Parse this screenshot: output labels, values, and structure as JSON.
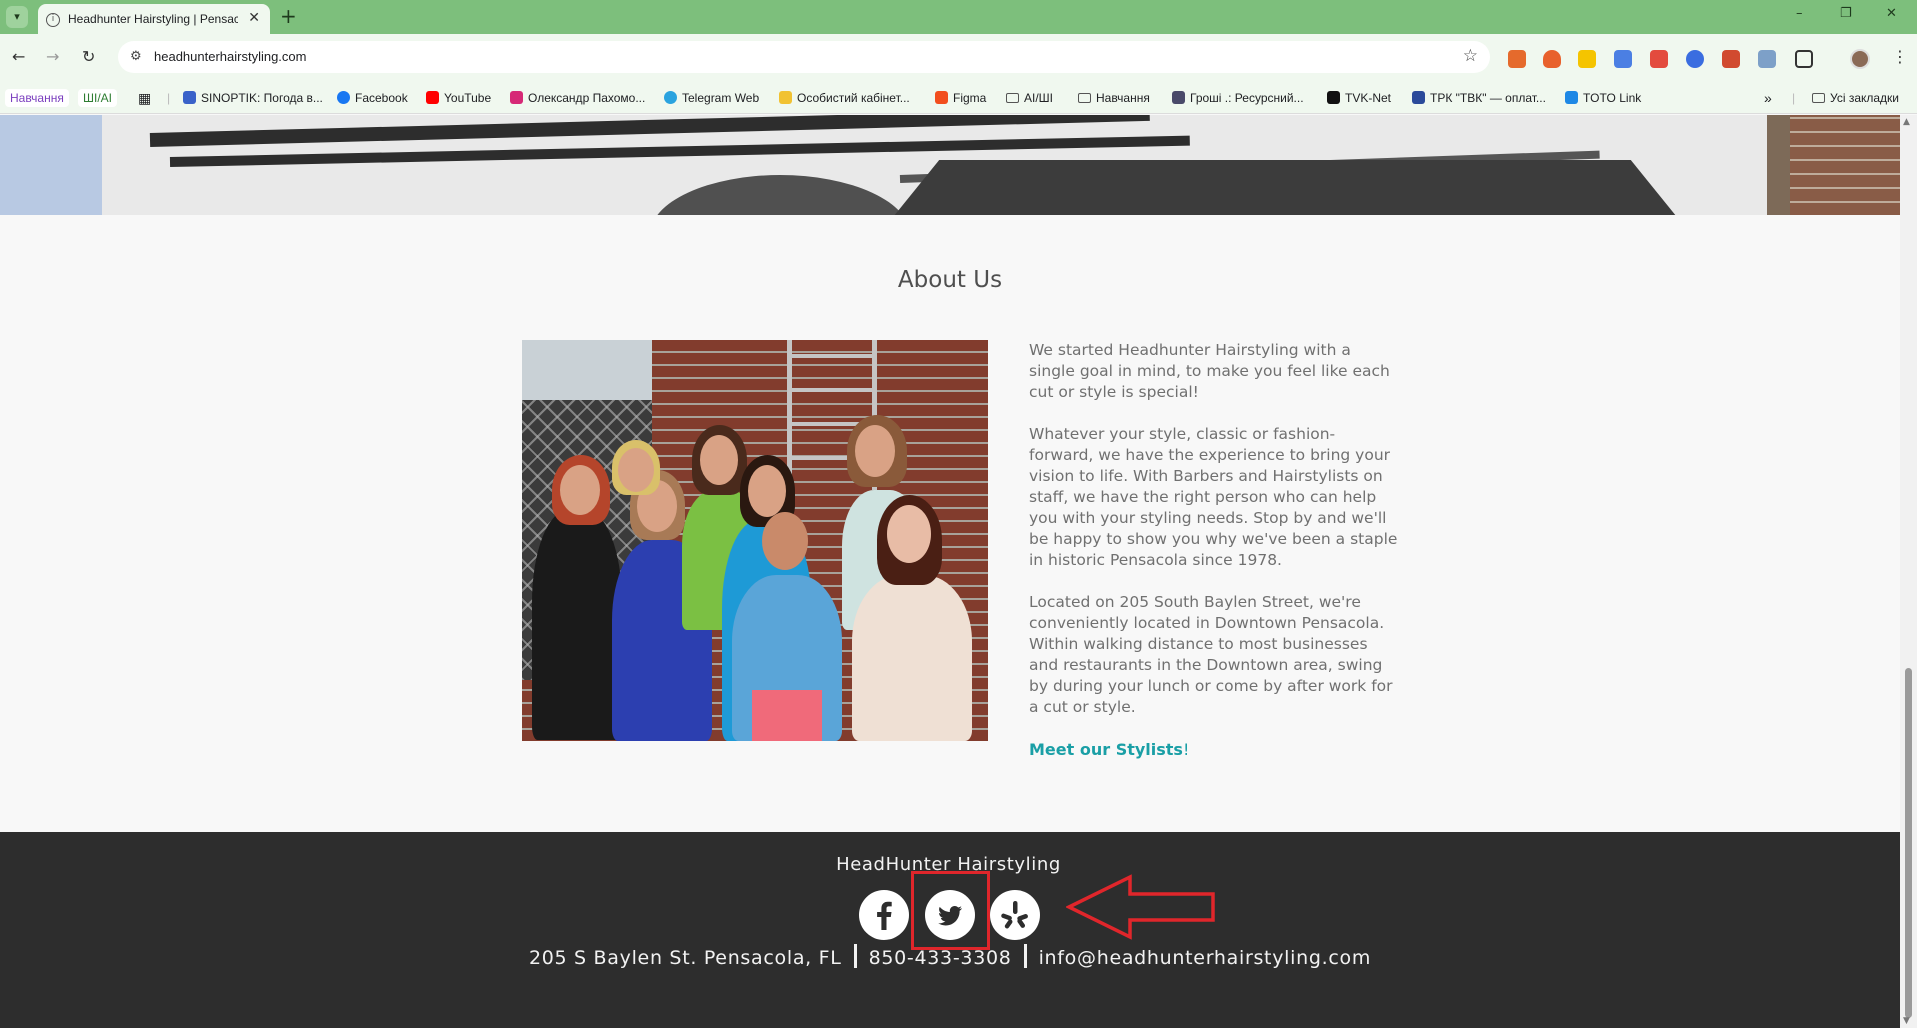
{
  "browser": {
    "tab_title": "Headhunter Hairstyling | Pensacola",
    "url": "headhunterhairstyling.com",
    "win_min": "–",
    "win_max": "❐",
    "win_close": "✕",
    "new_tab": "+",
    "tab_close": "✕"
  },
  "bookmarks": [
    {
      "label": "Навчання",
      "icon": "pill"
    },
    {
      "label": "ШІ/AI",
      "icon": "pill"
    },
    {
      "label": "",
      "icon": "grid-icon"
    },
    {
      "label": "SINOPTIK: Погода в...",
      "icon": "thermometer-icon"
    },
    {
      "label": "Facebook",
      "icon": "facebook-icon"
    },
    {
      "label": "YouTube",
      "icon": "youtube-icon"
    },
    {
      "label": "Олександр Пахомо...",
      "icon": "instagram-icon"
    },
    {
      "label": "Telegram Web",
      "icon": "telegram-icon"
    },
    {
      "label": "Особистий кабінет...",
      "icon": "cabinet-icon"
    },
    {
      "label": "Figma",
      "icon": "figma-icon"
    },
    {
      "label": "AI/ШІ",
      "icon": "folder-icon"
    },
    {
      "label": "Навчання",
      "icon": "folder-icon"
    },
    {
      "label": "Гроші .: Ресурсний...",
      "icon": "money-icon"
    },
    {
      "label": "TVK-Net",
      "icon": "tvk-icon"
    },
    {
      "label": "ТРК \"ТВК\" — оплат...",
      "icon": "trk-icon"
    },
    {
      "label": "TOTO Link",
      "icon": "toto-icon"
    },
    {
      "label": "»",
      "icon": "more-icon"
    },
    {
      "label": "Усі закладки",
      "icon": "folder-icon"
    }
  ],
  "page": {
    "section_title": "About Us",
    "paragraph1": "We started Headhunter Hairstyling with a single goal in mind, to make you feel like each cut or style is special!",
    "paragraph2": "Whatever your style, classic or fashion-forward, we have the experience to bring your vision to life. With Barbers and Hairstylists on staff, we have the right person who can help you with your styling needs. Stop by and we'll be happy to show you why we've been a staple in historic Pensacola since 1978.",
    "paragraph3": "Located on 205 South Baylen Street, we're conveniently located in Downtown Pensacola. Within walking distance to most businesses and restaurants in the Downtown area, swing by during your lunch or come by after work for a cut or style.",
    "stylists_link": "Meet our Stylists",
    "stylists_suffix": "!"
  },
  "footer": {
    "name": "HeadHunter Hairstyling",
    "address": "205 S Baylen St. Pensacola, FL",
    "phone": "850-433-3308",
    "email": "info@headhunterhairstyling.com",
    "social": [
      "facebook-icon",
      "twitter-icon",
      "yelp-icon"
    ]
  },
  "colors": {
    "accent": "#1a9fa6",
    "footer_bg": "#2d2d2d",
    "highlight": "#e0262b",
    "chrome_tab": "#7dbf7c"
  }
}
